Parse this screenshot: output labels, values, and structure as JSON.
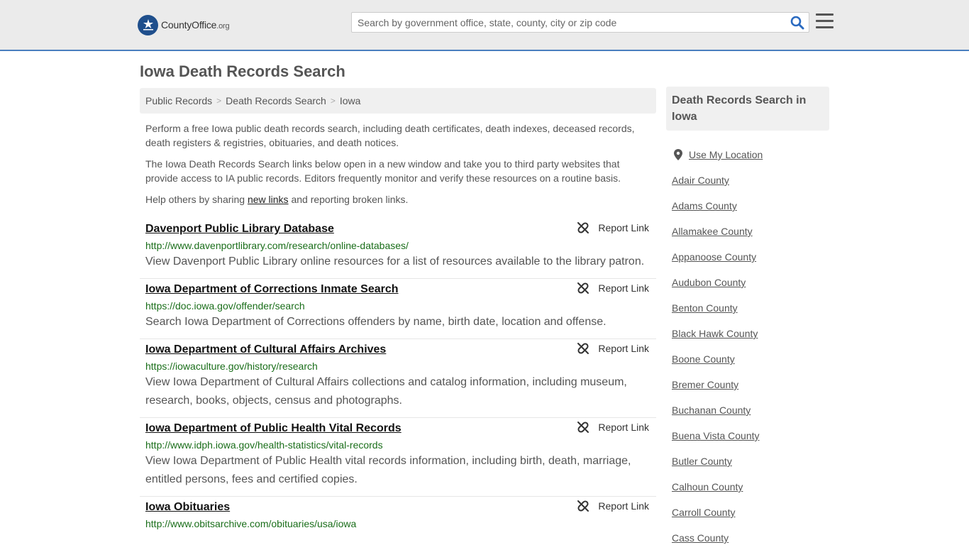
{
  "header": {
    "logo_main": "CountyOffice",
    "logo_suffix": ".org",
    "search_placeholder": "Search by government office, state, county, city or zip code"
  },
  "page_title": "Iowa Death Records Search",
  "breadcrumb": [
    "Public Records",
    "Death Records Search",
    "Iowa"
  ],
  "intro": {
    "p1": "Perform a free Iowa public death records search, including death certificates, death indexes, deceased records, death registers & registries, obituaries, and death notices.",
    "p2": "The Iowa Death Records Search links below open in a new window and take you to third party websites that provide access to IA public records. Editors frequently monitor and verify these resources on a routine basis.",
    "p3_before": "Help others by sharing ",
    "p3_link": "new links",
    "p3_after": " and reporting broken links."
  },
  "report_label": "Report Link",
  "results": [
    {
      "title": "Davenport Public Library Database",
      "url": "http://www.davenportlibrary.com/research/online-databases/",
      "desc": "View Davenport Public Library online resources for a list of resources available to the library patron."
    },
    {
      "title": "Iowa Department of Corrections Inmate Search",
      "url": "https://doc.iowa.gov/offender/search",
      "desc": "Search Iowa Department of Corrections offenders by name, birth date, location and offense."
    },
    {
      "title": "Iowa Department of Cultural Affairs Archives",
      "url": "https://iowaculture.gov/history/research",
      "desc": "View Iowa Department of Cultural Affairs collections and catalog information, including museum, research, books, objects, census and photographs."
    },
    {
      "title": "Iowa Department of Public Health Vital Records",
      "url": "http://www.idph.iowa.gov/health-statistics/vital-records",
      "desc": "View Iowa Department of Public Health vital records information, including birth, death, marriage, entitled persons, fees and certified copies."
    },
    {
      "title": "Iowa Obituaries",
      "url": "http://www.obitsarchive.com/obituaries/usa/iowa",
      "desc": ""
    }
  ],
  "sidebar": {
    "heading": "Death Records Search in Iowa",
    "location_label": "Use My Location",
    "counties": [
      "Adair County",
      "Adams County",
      "Allamakee County",
      "Appanoose County",
      "Audubon County",
      "Benton County",
      "Black Hawk County",
      "Boone County",
      "Bremer County",
      "Buchanan County",
      "Buena Vista County",
      "Butler County",
      "Calhoun County",
      "Carroll County",
      "Cass County"
    ]
  },
  "colors": {
    "header_bg": "#ebebeb",
    "header_border": "#4a7fbf",
    "logo_badge": "#1f4f8c",
    "search_icon": "#2a6ac0",
    "url_green": "#1a6e1a"
  }
}
